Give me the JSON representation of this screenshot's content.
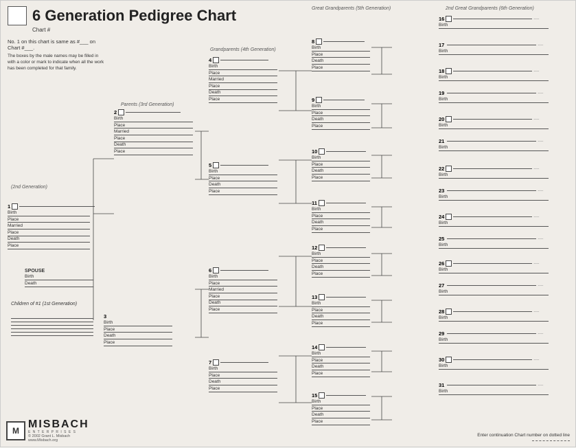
{
  "header": {
    "title": "6 Generation Pedigree Chart",
    "chart_label": "Chart #"
  },
  "info": {
    "same_as": "No. 1 on this chart is same\nas #___ on Chart #___.",
    "boxes_desc": "The boxes by the male names may be filled in with a color or mark to indicate when all the work has been completed for that family."
  },
  "generations": {
    "gen2": "(2nd Generation)",
    "gen3": "Parents (3rd Generation)",
    "gen4": "Grandparents (4th Generation)",
    "gen5": "Great Grandparents (5th Generation)",
    "gen6": "2nd Great Grandparents (6th Generation)"
  },
  "persons": {
    "p1": {
      "num": "1",
      "f1": "Birth",
      "f2": "Place",
      "f3": "Married",
      "f4": "Place",
      "f5": "Death",
      "f6": "Place"
    },
    "p2": {
      "num": "2",
      "f1": "Birth",
      "f2": "Place",
      "f3": "Married",
      "f4": "Place",
      "f5": "Death",
      "f6": "Place"
    },
    "p3": {
      "num": "3",
      "f1": "Birth",
      "f2": "Place",
      "f3": "Death",
      "f4": "Place"
    },
    "p4": {
      "num": "4",
      "f1": "Birth",
      "f2": "Place",
      "f3": "Married",
      "f4": "Place",
      "f5": "Death",
      "f6": "Place"
    },
    "p5": {
      "num": "5",
      "f1": "Birth",
      "f2": "Place",
      "f3": "Death",
      "f4": "Place"
    },
    "p6": {
      "num": "6",
      "f1": "Birth",
      "f2": "Place",
      "f3": "Married",
      "f4": "Place",
      "f5": "Death",
      "f6": "Place"
    },
    "p7": {
      "num": "7",
      "f1": "Birth",
      "f2": "Place",
      "f3": "Death",
      "f4": "Place"
    },
    "p8": {
      "num": "8",
      "f1": "Birth",
      "f2": "Place",
      "f3": "Death",
      "f4": "Place"
    },
    "p9": {
      "num": "9",
      "f1": "Birth",
      "f2": "Place",
      "f3": "Death",
      "f4": "Place"
    },
    "p10": {
      "num": "10",
      "f1": "Birth",
      "f2": "Place",
      "f3": "Death",
      "f4": "Place"
    },
    "p11": {
      "num": "11",
      "f1": "Birth",
      "f2": "Place",
      "f3": "Death",
      "f4": "Place"
    },
    "p12": {
      "num": "12",
      "f1": "Birth",
      "f2": "Place",
      "f3": "Death",
      "f4": "Place"
    },
    "p13": {
      "num": "13",
      "f1": "Birth",
      "f2": "Place",
      "f3": "Death",
      "f4": "Place"
    },
    "p14": {
      "num": "14",
      "f1": "Birth",
      "f2": "Place",
      "f3": "Death",
      "f4": "Place"
    },
    "p15": {
      "num": "15",
      "f1": "Birth",
      "f2": "Place",
      "f3": "Death",
      "f4": "Place"
    },
    "p16": {
      "num": "16",
      "f1": "Birth"
    },
    "p17": {
      "num": "17",
      "f1": "Birth"
    },
    "p18": {
      "num": "18",
      "f1": "Birth"
    },
    "p19": {
      "num": "19",
      "f1": "Birth"
    },
    "p20": {
      "num": "20",
      "f1": "Birth"
    },
    "p21": {
      "num": "21",
      "f1": "Birth"
    },
    "p22": {
      "num": "22",
      "f1": "Birth"
    },
    "p23": {
      "num": "23",
      "f1": "Birth"
    },
    "p24": {
      "num": "24",
      "f1": "Birth"
    },
    "p25": {
      "num": "25",
      "f1": "Birth"
    },
    "p26": {
      "num": "26",
      "f1": "Birth"
    },
    "p27": {
      "num": "27",
      "f1": "Birth"
    },
    "p28": {
      "num": "28",
      "f1": "Birth"
    },
    "p29": {
      "num": "29",
      "f1": "Birth"
    },
    "p30": {
      "num": "30",
      "f1": "Birth"
    },
    "p31": {
      "num": "31",
      "f1": "Birth"
    }
  },
  "spouse": {
    "label": "SPOUSE",
    "birth": "Birth",
    "death": "Death"
  },
  "children": {
    "label": "Children of #1 (1st Generation)"
  },
  "footer": {
    "brand": "MISBACH",
    "enterprise": "E N T E R P R I S E S",
    "copyright": "© 2002 Grant L. Misbach",
    "website": "www.Misbach.org",
    "continuation_note": "Enter continuation Chart\nnumber on dotted line"
  }
}
